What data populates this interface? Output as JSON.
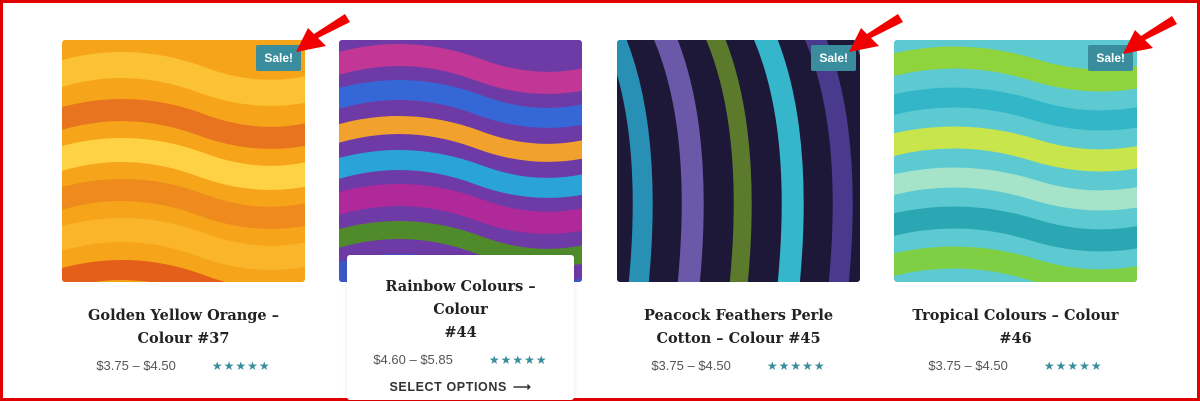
{
  "badge_label": "Sale!",
  "products": [
    {
      "title_line1": "Golden Yellow Orange –",
      "title_line2": "Colour #37",
      "price": "$3.75 – $4.50",
      "rating": "★★★★★",
      "on_sale": true,
      "colors": [
        "#f4a10b",
        "#fbbd1e",
        "#e56a1a",
        "#ffcf3a"
      ]
    },
    {
      "title_line1": "Rainbow Colours – Colour",
      "title_line2": "#44",
      "price": "$4.60 – $5.85",
      "rating": "★★★★★",
      "on_sale": false,
      "action": "SELECT OPTIONS",
      "action_arrow": "⟶",
      "colors": [
        "#b0299a",
        "#3561d4",
        "#f0a22d",
        "#6f3bb2",
        "#2e9fd7"
      ]
    },
    {
      "title_line1": "Peacock Feathers Perle",
      "title_line2": "Cotton – Colour #45",
      "price": "$3.75 – $4.50",
      "rating": "★★★★★",
      "on_sale": true,
      "colors": [
        "#2b1e52",
        "#1f8fb3",
        "#6d5aa8",
        "#5f7d2e",
        "#33b4c9"
      ]
    },
    {
      "title_line1": "Tropical Colours – Colour",
      "title_line2": "#46",
      "price": "$3.75 – $4.50",
      "rating": "★★★★★",
      "on_sale": true,
      "colors": [
        "#39c3d2",
        "#88d23a",
        "#c9e64a",
        "#2ea9b5",
        "#a4e2c8"
      ]
    }
  ]
}
